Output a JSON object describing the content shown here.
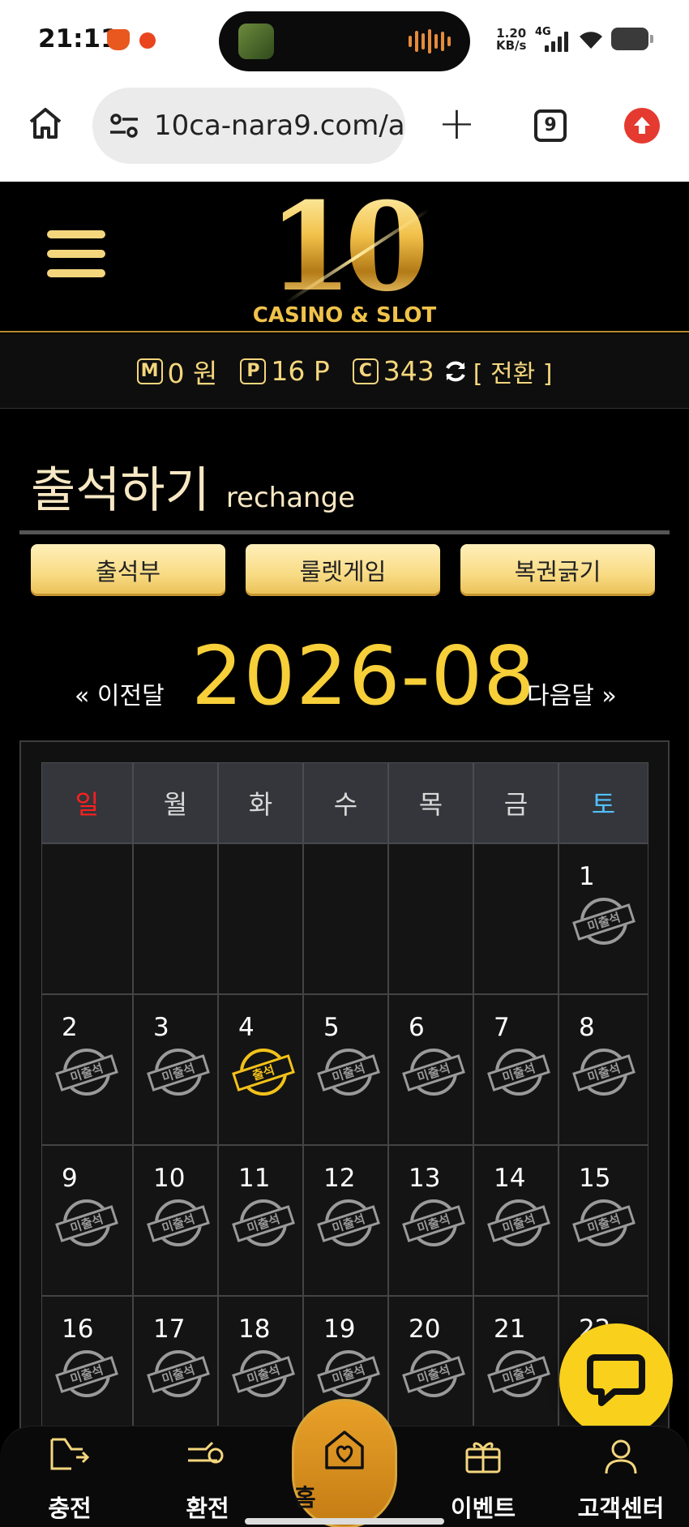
{
  "status_bar": {
    "time": "21:11",
    "net_speed": "1.20",
    "net_speed_unit": "KB/s",
    "network_type": "4G"
  },
  "browser": {
    "url": "10ca-nara9.com/a",
    "tab_count": "9"
  },
  "header": {
    "logo_number": "10",
    "logo_subtitle": "CASINO & SLOT"
  },
  "points": {
    "money_icon": "M",
    "money_value": "0 원",
    "point_icon": "P",
    "point_value": "16 P",
    "coin_icon": "C",
    "coin_value": "343",
    "switch_label": "[ 전환 ]"
  },
  "page": {
    "title": "출석하기",
    "subtitle": "rechange"
  },
  "tabs": [
    {
      "label": "출석부"
    },
    {
      "label": "룰렛게임"
    },
    {
      "label": "복권긁기"
    }
  ],
  "month_nav": {
    "prev_label": "« 이전달",
    "current": "2026-08",
    "next_label": "다음달 »"
  },
  "calendar": {
    "weekdays": [
      "일",
      "월",
      "화",
      "수",
      "목",
      "금",
      "토"
    ],
    "stamp_absent": "미출석",
    "stamp_present": "출석",
    "days": [
      {
        "day": "",
        "status": ""
      },
      {
        "day": "",
        "status": ""
      },
      {
        "day": "",
        "status": ""
      },
      {
        "day": "",
        "status": ""
      },
      {
        "day": "",
        "status": ""
      },
      {
        "day": "",
        "status": ""
      },
      {
        "day": "1",
        "status": "absent"
      },
      {
        "day": "2",
        "status": "absent"
      },
      {
        "day": "3",
        "status": "absent"
      },
      {
        "day": "4",
        "status": "present"
      },
      {
        "day": "5",
        "status": "absent"
      },
      {
        "day": "6",
        "status": "absent"
      },
      {
        "day": "7",
        "status": "absent"
      },
      {
        "day": "8",
        "status": "absent"
      },
      {
        "day": "9",
        "status": "absent"
      },
      {
        "day": "10",
        "status": "absent"
      },
      {
        "day": "11",
        "status": "absent"
      },
      {
        "day": "12",
        "status": "absent"
      },
      {
        "day": "13",
        "status": "absent"
      },
      {
        "day": "14",
        "status": "absent"
      },
      {
        "day": "15",
        "status": "absent"
      },
      {
        "day": "16",
        "status": "absent"
      },
      {
        "day": "17",
        "status": "absent"
      },
      {
        "day": "18",
        "status": "absent"
      },
      {
        "day": "19",
        "status": "absent"
      },
      {
        "day": "20",
        "status": "absent"
      },
      {
        "day": "21",
        "status": "absent"
      },
      {
        "day": "22",
        "status": "absent"
      }
    ]
  },
  "bottom_nav": [
    {
      "label": "충전",
      "icon": "deposit-icon"
    },
    {
      "label": "환전",
      "icon": "withdraw-icon"
    },
    {
      "label": "홈",
      "icon": "home-heart-icon"
    },
    {
      "label": "이벤트",
      "icon": "gift-icon"
    },
    {
      "label": "고객센터",
      "icon": "support-agent-icon"
    }
  ],
  "colors": {
    "gold": "#f4d67d",
    "accent_yellow": "#f6cf39",
    "sunday": "#ff1f1f",
    "saturday": "#52c0ff",
    "chat_button": "#f9d01c"
  }
}
